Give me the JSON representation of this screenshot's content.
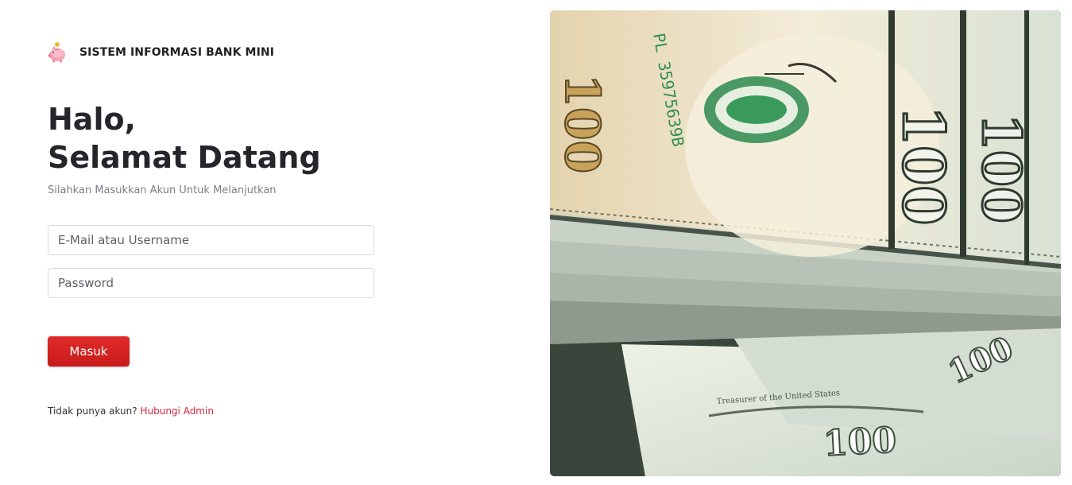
{
  "app": {
    "title": "SISTEM INFORMASI BANK MINI",
    "logo_icon": "piggy-bank-icon"
  },
  "login": {
    "greeting_line1": "Halo,",
    "greeting_line2": "Selamat Datang",
    "subtitle": "Silahkan Masukkan Akun Untuk Melanjutkan",
    "email_placeholder": "E-Mail atau Username",
    "email_value": "",
    "password_placeholder": "Password",
    "password_value": "",
    "submit_label": "Masuk",
    "no_account_text": "Tidak punya akun?",
    "contact_admin_link": "Hubungi Admin"
  },
  "hero_image": {
    "subject": "stack of 100 dollar bills",
    "bill_denomination": "100",
    "serial_fragment": "PL 35975639B",
    "signature_label": "Treasurer of the United States"
  },
  "colors": {
    "primary_button": "#d62222",
    "link": "#d12538",
    "heading": "#24262b",
    "subtitle": "#7b7f85"
  }
}
